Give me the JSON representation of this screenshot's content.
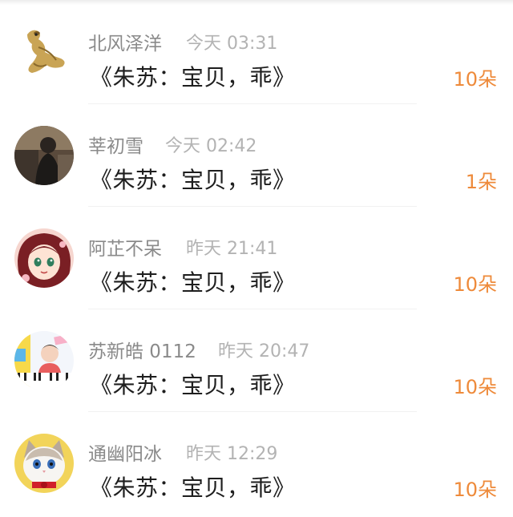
{
  "entries": [
    {
      "name": "北风泽洋",
      "time": "今天 03:31",
      "gift": "《朱苏：宝贝，乖》",
      "count": "10朵",
      "avatar": "golden-dragon-avatar"
    },
    {
      "name": "莘初雪",
      "time": "今天 02:42",
      "gift": "《朱苏：宝贝，乖》",
      "count": "1朵",
      "avatar": "person-photo-avatar"
    },
    {
      "name": "阿芷不呆",
      "time": "昨天 21:41",
      "gift": "《朱苏：宝贝，乖》",
      "count": "10朵",
      "avatar": "anime-girl-avatar"
    },
    {
      "name": "苏新皓 0112",
      "time": "昨天 20:47",
      "gift": "《朱苏：宝贝，乖》",
      "count": "10朵",
      "avatar": "piano-boy-avatar"
    },
    {
      "name": "通幽阳冰",
      "time": "昨天 12:29",
      "gift": "《朱苏：宝贝，乖》",
      "count": "10朵",
      "avatar": "cat-avatar"
    }
  ],
  "colors": {
    "name": "#8a8a8a",
    "time": "#b3b3b3",
    "gift": "#1e1e1e",
    "count": "#ee8a3a"
  }
}
